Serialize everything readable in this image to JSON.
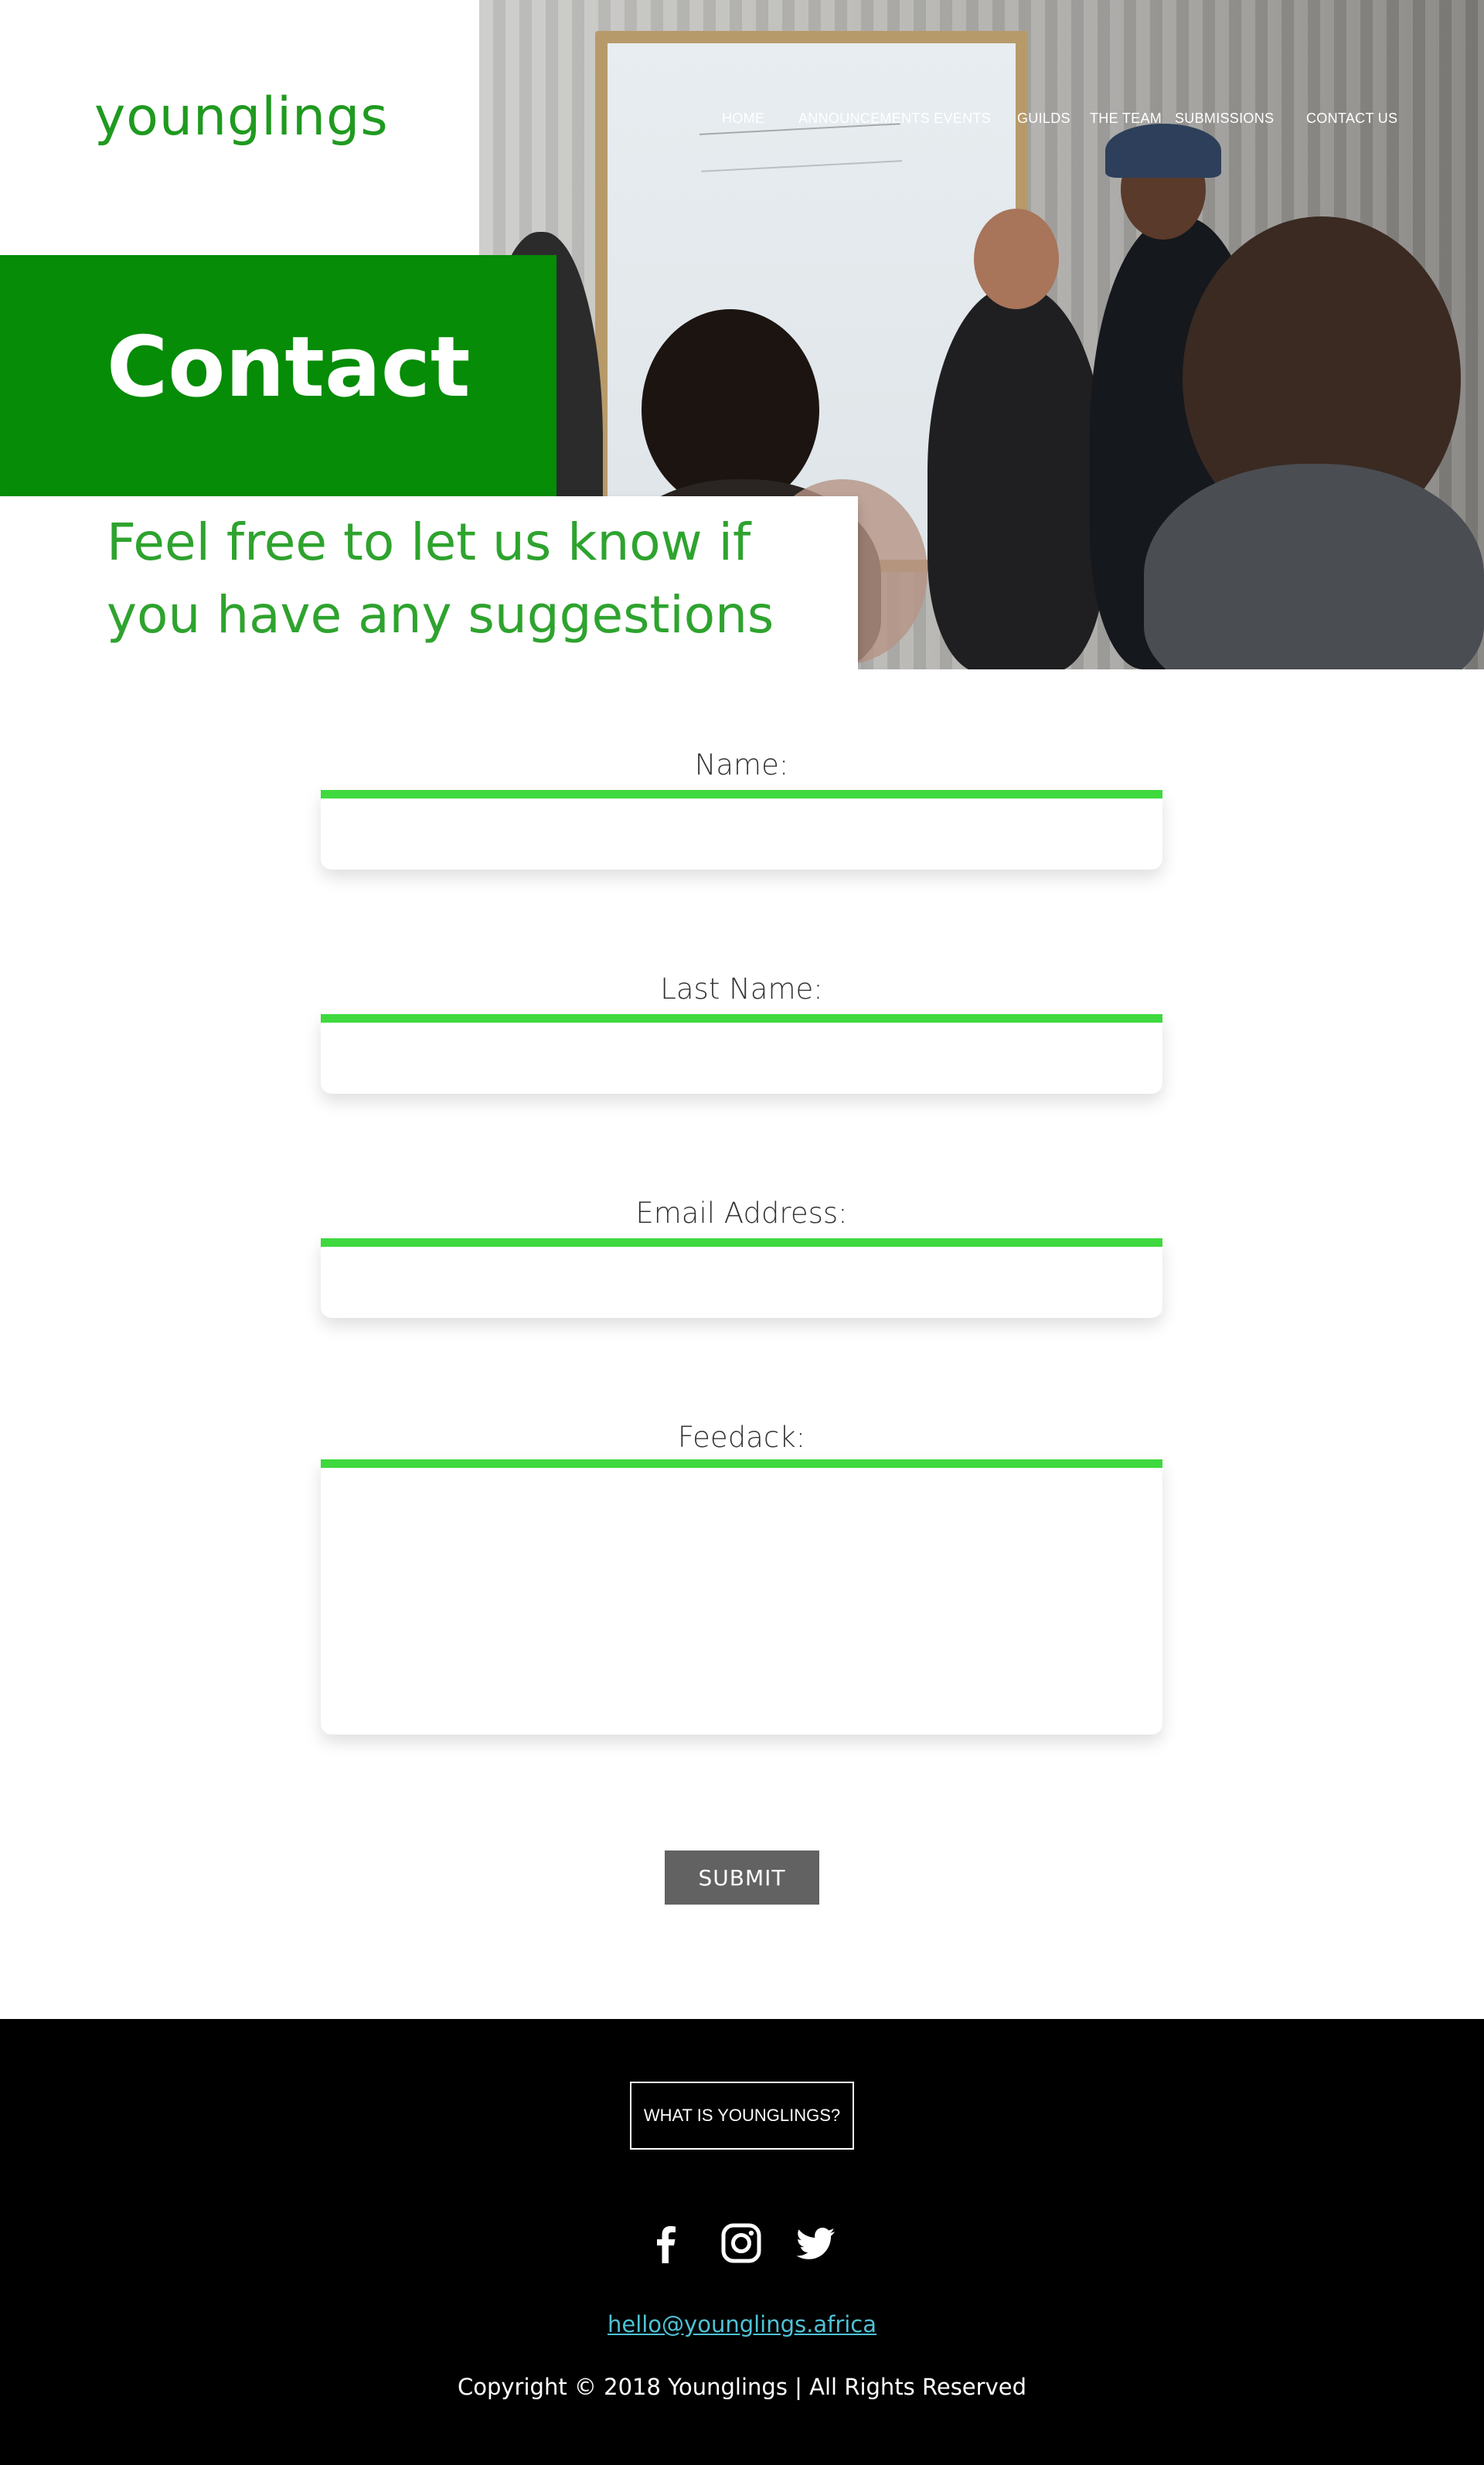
{
  "brand": {
    "logo": "younglings",
    "color_primary": "#068c06",
    "color_logo": "#1f9a1f",
    "color_accent": "#3fd93f"
  },
  "nav": {
    "items": [
      {
        "label": "HOME"
      },
      {
        "label": "ANNOUNCEMENTS EVENTS"
      },
      {
        "label": "GUILDS"
      },
      {
        "label": "THE TEAM"
      },
      {
        "label": "SUBMISSIONS"
      },
      {
        "label": "CONTACT US"
      }
    ]
  },
  "hero": {
    "title": "Contact",
    "tagline": "Feel free to let us know if you have any suggestions or"
  },
  "form": {
    "name_label": "Name:",
    "name_value": "",
    "last_name_label": "Last Name:",
    "last_name_value": "",
    "email_label": "Email Address:",
    "email_value": "",
    "feedback_label": "Feedack:",
    "feedback_value": "",
    "submit_label": "SUBMIT"
  },
  "footer": {
    "about_button": "WHAT IS YOUNGLINGS?",
    "social_icons": [
      "facebook-icon",
      "instagram-icon",
      "twitter-icon"
    ],
    "email": "hello@younglings.africa",
    "copyright": "Copyright © 2018 Younglings | All Rights Reserved",
    "link_color": "#4fc2d6"
  }
}
